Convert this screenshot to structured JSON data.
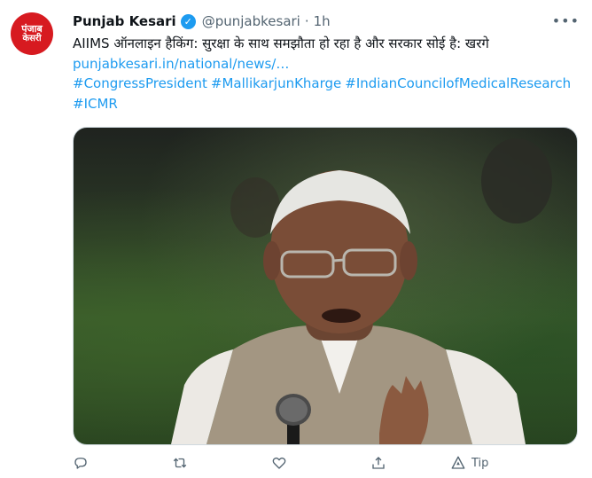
{
  "account": {
    "name": "Punjab Kesari",
    "handle": "@punjabkesari",
    "separator": "·",
    "time": "1h",
    "avatar_line1": "पंजाब",
    "avatar_line2": "केसरी",
    "verified_icon": "verified-badge-icon"
  },
  "tweet": {
    "text": "AIIMS ऑनलाइन हैकिंग: सुरक्षा के साथ समझौता हो रहा है और सरकार सोई है: खरगे",
    "link": "punjabkesari.in/national/news/…",
    "hashtags": [
      "#CongressPresident",
      "#MallikarjunKharge",
      "#IndianCouncilofMedicalResearch",
      "#ICMR"
    ]
  },
  "media": {
    "description_icon": "photo-of-speaker-with-microphone"
  },
  "actions": {
    "reply_icon": "reply-icon",
    "retweet_icon": "retweet-icon",
    "like_icon": "like-icon",
    "share_icon": "share-icon",
    "tip_label": "Tip"
  },
  "colors": {
    "accent": "#1d9bf0",
    "secondary_text": "#536471",
    "brand_red": "#d71a20"
  }
}
